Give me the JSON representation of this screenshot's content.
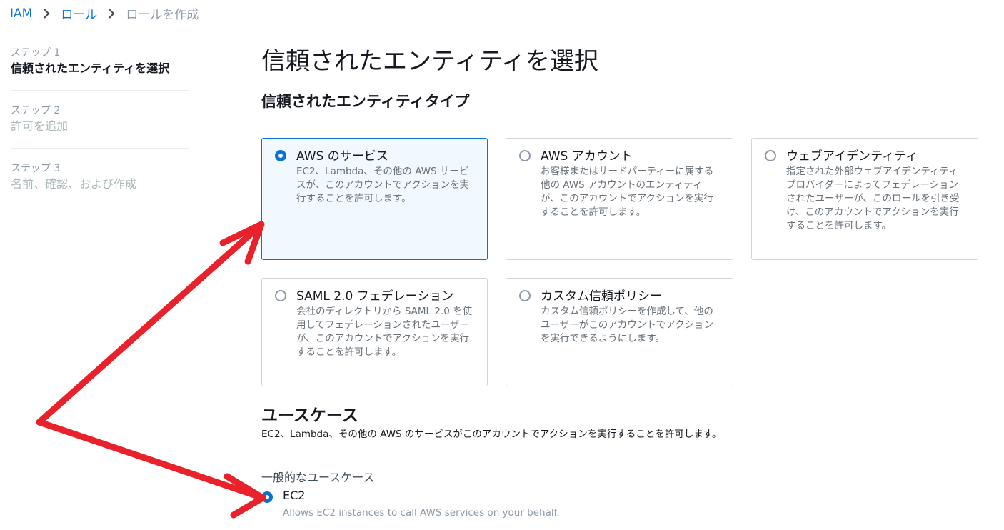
{
  "breadcrumb": {
    "items": [
      "IAM",
      "ロール"
    ],
    "current": "ロールを作成"
  },
  "steps": [
    {
      "num": "ステップ 1",
      "title": "信頼されたエンティティを選択"
    },
    {
      "num": "ステップ 2",
      "title": "許可を追加"
    },
    {
      "num": "ステップ 3",
      "title": "名前、確認、および作成"
    }
  ],
  "main": {
    "title": "信頼されたエンティティを選択",
    "section_title": "信頼されたエンティティタイプ",
    "tiles": [
      {
        "title": "AWS のサービス",
        "desc": "EC2、Lambda、その他の AWS サービスが、このアカウントでアクションを実行することを許可します。",
        "selected": true
      },
      {
        "title": "AWS アカウント",
        "desc": "お客様またはサードパーティーに属する他の AWS アカウントのエンティティが、このアカウントでアクションを実行することを許可します。",
        "selected": false
      },
      {
        "title": "ウェブアイデンティティ",
        "desc": "指定された外部ウェブアイデンティティプロバイダーによってフェデレーションされたユーザーが、このロールを引き受け、このアカウントでアクションを実行することを許可します。",
        "selected": false
      },
      {
        "title": "SAML 2.0 フェデレーション",
        "desc": "会社のディレクトリから SAML 2.0 を使用してフェデレーションされたユーザーが、このアカウントでアクションを実行することを許可します。",
        "selected": false
      },
      {
        "title": "カスタム信頼ポリシー",
        "desc": "カスタム信頼ポリシーを作成して、他のユーザーがこのアカウントでアクションを実行できるようにします。",
        "selected": false
      }
    ],
    "use_case": {
      "title": "ユースケース",
      "desc": "EC2、Lambda、その他の AWS のサービスがこのアカウントでアクションを実行することを許可します。",
      "common_label": "一般的なユースケース",
      "option": {
        "title": "EC2",
        "desc": "Allows EC2 instances to call AWS services on your behalf.",
        "selected": true
      }
    }
  },
  "colors": {
    "accent": "#0972d3",
    "annotation": "#e8212b"
  }
}
